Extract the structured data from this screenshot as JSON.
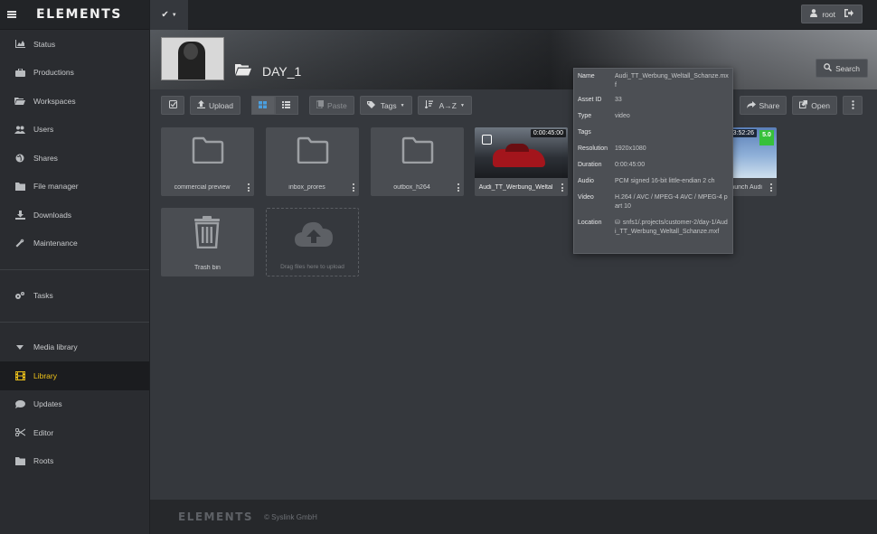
{
  "app": {
    "logo": "ELEMENTS"
  },
  "sidebar": {
    "items": [
      {
        "label": "Status",
        "icon": "chart-icon"
      },
      {
        "label": "Productions",
        "icon": "briefcase-icon"
      },
      {
        "label": "Workspaces",
        "icon": "folder-open-icon"
      },
      {
        "label": "Users",
        "icon": "users-icon"
      },
      {
        "label": "Shares",
        "icon": "globe-icon"
      },
      {
        "label": "File manager",
        "icon": "file-icon"
      },
      {
        "label": "Downloads",
        "icon": "download-icon"
      },
      {
        "label": "Maintenance",
        "icon": "wrench-icon"
      }
    ],
    "tasks": {
      "label": "Tasks",
      "icon": "cogs-icon"
    },
    "media": [
      {
        "label": "Media library",
        "icon": "caret-down-icon"
      },
      {
        "label": "Library",
        "icon": "film-icon",
        "active": true
      },
      {
        "label": "Updates",
        "icon": "comment-icon"
      },
      {
        "label": "Editor",
        "icon": "scissors-icon"
      },
      {
        "label": "Roots",
        "icon": "folder-icon"
      }
    ]
  },
  "topbar": {
    "user_label": "root"
  },
  "banner": {
    "title": "DAY_1",
    "search_label": "Search"
  },
  "toolbar": {
    "upload_label": "Upload",
    "paste_label": "Paste",
    "tags_label": "Tags",
    "sort_label": "A→Z",
    "share_label": "Share",
    "open_label": "Open"
  },
  "tiles": {
    "folder1": "commercial preview",
    "folder2": "inbox_prores",
    "folder3": "outbox_h264",
    "video1": {
      "label": "Audi_TT_Werbung_Weltal",
      "duration": "0:00:45:00"
    },
    "video2": {
      "label": "Launch Audi",
      "duration": "0:03:52:26",
      "score": "5.0"
    },
    "trash": "Trash bin",
    "dropzone": "Drag files here to upload"
  },
  "popover": {
    "rows": [
      {
        "key": "Name",
        "value": "Audi_TT_Werbung_Weltall_Schanze.mxf"
      },
      {
        "key": "Asset ID",
        "value": "33"
      },
      {
        "key": "Type",
        "value": "video"
      },
      {
        "key": "Tags",
        "value": ""
      },
      {
        "key": "Resolution",
        "value": "1920x1080"
      },
      {
        "key": "Duration",
        "value": "0:00:45:00"
      },
      {
        "key": "Audio",
        "value": "PCM signed 16-bit little-endian 2 ch"
      },
      {
        "key": "Video",
        "value": "H.264 / AVC / MPEG-4 AVC / MPEG-4 part 10"
      },
      {
        "key": "Location",
        "value": "snfs1/.projects/customer-2/day-1/Audi_TT_Werbung_Weltall_Schanze.mxf"
      }
    ]
  },
  "footer": {
    "logo": "ELEMENTS",
    "copyright": "© Syslink GmbH"
  }
}
